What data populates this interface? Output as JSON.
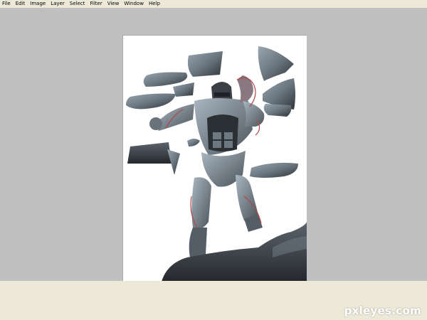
{
  "menubar": {
    "items": [
      {
        "label": "File"
      },
      {
        "label": "Edit"
      },
      {
        "label": "Image"
      },
      {
        "label": "Layer"
      },
      {
        "label": "Select"
      },
      {
        "label": "Filter"
      },
      {
        "label": "View"
      },
      {
        "label": "Window"
      },
      {
        "label": "Help"
      }
    ]
  },
  "watermark": {
    "text": "pxleyes.com"
  },
  "colors": {
    "menubar_bg": "#ece9d8",
    "workspace_bg": "#c0c0c0",
    "canvas_bg": "#ffffff",
    "stone_dark": "#2f3136",
    "stone_mid": "#7d8a95",
    "sketch_line": "#b0484a"
  }
}
